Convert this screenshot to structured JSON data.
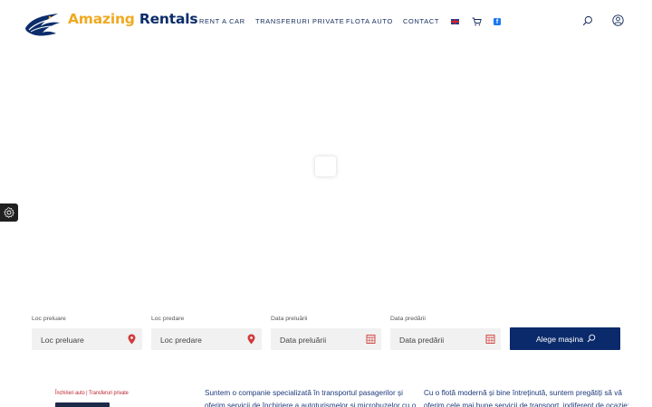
{
  "brand": {
    "part1": "Amazing",
    "part2": "Rentals"
  },
  "nav": [
    {
      "label": "RENT A CAR"
    },
    {
      "label": "TRANSFERURI PRIVATE"
    },
    {
      "label": "FLOTA AUTO"
    },
    {
      "label": "CONTACT"
    }
  ],
  "header_icons": {
    "language": "uk-flag-icon",
    "cart": "cart-icon",
    "facebook": "facebook-icon",
    "facebook_letter": "f",
    "search": "search-icon",
    "account": "user-icon"
  },
  "booking": {
    "pickup_location": {
      "label": "Loc preluare",
      "placeholder": "Loc preluare"
    },
    "dropoff_location": {
      "label": "Loc predare",
      "placeholder": "Loc predare"
    },
    "pickup_date": {
      "label": "Data preluării",
      "placeholder": "Data preluării"
    },
    "dropoff_date": {
      "label": "Data predării",
      "placeholder": "Data predării"
    },
    "submit_label": "Alege mașina"
  },
  "footer": {
    "logo_tagline": "Închirieri auto | Transferuri private",
    "col2_line1": "Suntem o companie specializată în transportul pasagerilor și",
    "col2_line2": "oferim servicii de închiriere a autoturismelor și microbuzelor cu o",
    "col3_line1": "Cu o flotă modernă și bine întreținută, suntem pregătiți să vă",
    "col3_line2": "oferim cele mai bune servicii de transport, indiferent de ocazie:"
  },
  "colors": {
    "brand_orange": "#f0a921",
    "brand_navy": "#0c2d6b",
    "button_navy": "#0b2a6b",
    "accent_red": "#d13b3b"
  }
}
